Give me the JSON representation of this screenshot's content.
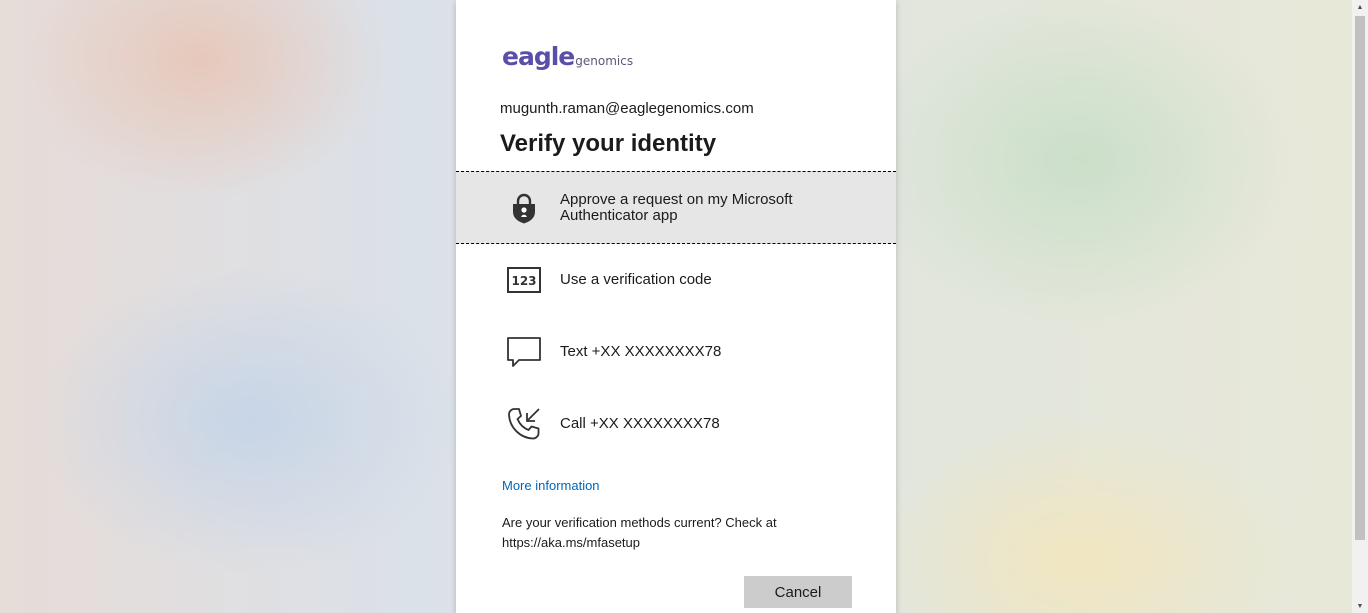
{
  "logo": {
    "main": "eagle",
    "sub": "genomics"
  },
  "user_email": "mugunth.raman@eaglegenomics.com",
  "title": "Verify your identity",
  "options": [
    {
      "icon": "authenticator-lock-icon",
      "label": "Approve a request on my Microsoft Authenticator app",
      "selected": true
    },
    {
      "icon": "verification-code-icon",
      "icon_text": "123",
      "label": "Use a verification code",
      "selected": false
    },
    {
      "icon": "text-message-icon",
      "label": "Text +XX XXXXXXXX78",
      "selected": false
    },
    {
      "icon": "phone-call-icon",
      "label": "Call +XX XXXXXXXX78",
      "selected": false
    }
  ],
  "more_info": "More information",
  "check_text": "Are your verification methods current? Check at https://aka.ms/mfasetup",
  "cancel_label": "Cancel",
  "colors": {
    "link": "#0067b8",
    "brand": "#5a4fa8",
    "button_bg": "#cccccc",
    "selected_bg": "#e6e6e6"
  }
}
